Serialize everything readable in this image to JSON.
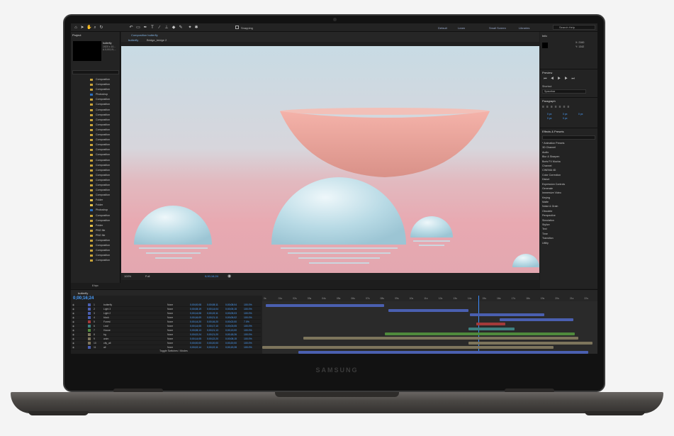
{
  "device": {
    "brand": "SAMSUNG"
  },
  "app": {
    "workspaces": [
      "Default",
      "Learn",
      "Small Screen",
      "Libraries"
    ],
    "toolbar_label": "Snapping",
    "search_help": "Search Help"
  },
  "project": {
    "title": "Project",
    "selected_item": "butterfly",
    "info": [
      "1920 x 10...",
      "Δ 0;00;19;..."
    ],
    "items": [
      "Composition",
      "Composition",
      "Composition",
      "Photoshop",
      "Composition",
      "Composition",
      "Composition",
      "Composition",
      "Composition",
      "Composition",
      "Composition",
      "Composition",
      "Composition",
      "Composition",
      "Composition",
      "Composition",
      "Composition",
      "Composition",
      "Composition",
      "Composition",
      "Composition",
      "Composition",
      "Composition",
      "Composition",
      "Folder",
      "Folder",
      "Photoshop",
      "Composition",
      "Composition",
      "Folder",
      "PNG file",
      "PNG file",
      "Composition",
      "Composition",
      "Composition",
      "Composition",
      "Composition"
    ],
    "bpc": "8 bpc"
  },
  "composition": {
    "tab_label": "Composition butterfly",
    "subtabs": [
      "butterfly",
      "Bridge_bridge 2"
    ],
    "zoom": "100%",
    "quality": "Full",
    "timecode": "0;00;16;24"
  },
  "right_panel": {
    "info_title": "Info",
    "info_values": [
      "X: 2160",
      "Y: 1342"
    ],
    "preview_title": "Preview",
    "shortcut_label": "Shortcut",
    "shortcut_value": "Spacebar",
    "paragraph_title": "Paragraph",
    "para_values": [
      "0 px",
      "0 px",
      "0 px",
      "0 px",
      "0 px"
    ],
    "effects_title": "Effects & Presets",
    "effects": [
      "* Animation Presets",
      "3D Channel",
      "Audio",
      "Blur & Sharpen",
      "Boris FX Mocha",
      "Channel",
      "CINEMA 4D",
      "Color Correction",
      "Distort",
      "Expression Controls",
      "Generate",
      "Immersive Video",
      "Keying",
      "Matte",
      "Noise & Grain",
      "Obsolete",
      "Perspective",
      "Simulation",
      "Stylize",
      "Text",
      "Time",
      "Transition",
      "Utility"
    ]
  },
  "timeline": {
    "comp_name": "butterfly",
    "timecode": "0;00;16;24",
    "footer": "Toggle Switches / Modes",
    "columns": [
      "Layer Name",
      "Mode",
      "Parent & Link",
      "In",
      "Out",
      "Duration",
      "Stretch"
    ],
    "layers": [
      {
        "num": "1",
        "name": "butterfly",
        "mode": "None",
        "in": "0;00;00;08",
        "out": "0;00;08;11",
        "dur": "0;00;08;04",
        "stretch": "100.0%",
        "color": "#4a5fb0"
      },
      {
        "num": "2",
        "name": "Light 3",
        "mode": "None",
        "in": "0;00;08;19",
        "out": "0;00;14;04",
        "dur": "0;00;05;15",
        "stretch": "100.0%",
        "color": "#4a5fb0"
      },
      {
        "num": "3",
        "name": "Light 2",
        "mode": "None",
        "in": "0;00;14;08",
        "out": "0;00;19;11",
        "dur": "0;00;05;03",
        "stretch": "100.0%",
        "color": "#4a5fb0"
      },
      {
        "num": "4",
        "name": "block",
        "mode": "None",
        "in": "0;00;16;09",
        "out": "0;00;21;11",
        "dur": "0;00;05;02",
        "stretch": "100.0%",
        "color": "#4a5fb0"
      },
      {
        "num": "5",
        "name": "Forest",
        "mode": "None",
        "in": "0;00;14;20",
        "out": "0;00;16;20",
        "dur": "0;00;02;00",
        "stretch": "7.0%",
        "color": "#a33a3a"
      },
      {
        "num": "6",
        "name": "Leaf",
        "mode": "None",
        "in": "0;00;14;05",
        "out": "0;00;17;10",
        "dur": "0;00;03;05",
        "stretch": "100.0%",
        "color": "#3e7f7f"
      },
      {
        "num": "7",
        "name": "House",
        "mode": "None",
        "in": "0;00;08;13",
        "out": "0;00;21;13",
        "dur": "0;00;13;00",
        "stretch": "100.0%",
        "color": "#4f8a3c"
      },
      {
        "num": "8",
        "name": "bg",
        "mode": "None",
        "in": "0;00;02;24",
        "out": "0;00;21;20",
        "dur": "0;00;18;26",
        "stretch": "100.0%",
        "color": "#7d755c"
      },
      {
        "num": "9",
        "name": "anim",
        "mode": "None",
        "in": "0;00;14;05",
        "out": "0;00;22;20",
        "dur": "0;00;08;15",
        "stretch": "100.0%",
        "color": "#7d755c"
      },
      {
        "num": "10",
        "name": "city_all",
        "mode": "None",
        "in": "0;00;00;00",
        "out": "0;00;20;00",
        "dur": "0;00;20;00",
        "stretch": "100.0%",
        "color": "#7d755c"
      },
      {
        "num": "11",
        "name": "all",
        "mode": "None",
        "in": "0;00;02;14",
        "out": "0;00;22;11",
        "dur": "0;00;19;28",
        "stretch": "100.0%",
        "color": "#4a5fb0"
      }
    ],
    "ruler": [
      "0s",
      "01s",
      "02s",
      "03s",
      "04s",
      "05s",
      "06s",
      "07s",
      "08s",
      "09s",
      "10s",
      "11s",
      "12s",
      "13s",
      "14s",
      "15s",
      "16s",
      "17s",
      "18s",
      "19s",
      "20s",
      "21s",
      "22s"
    ]
  }
}
